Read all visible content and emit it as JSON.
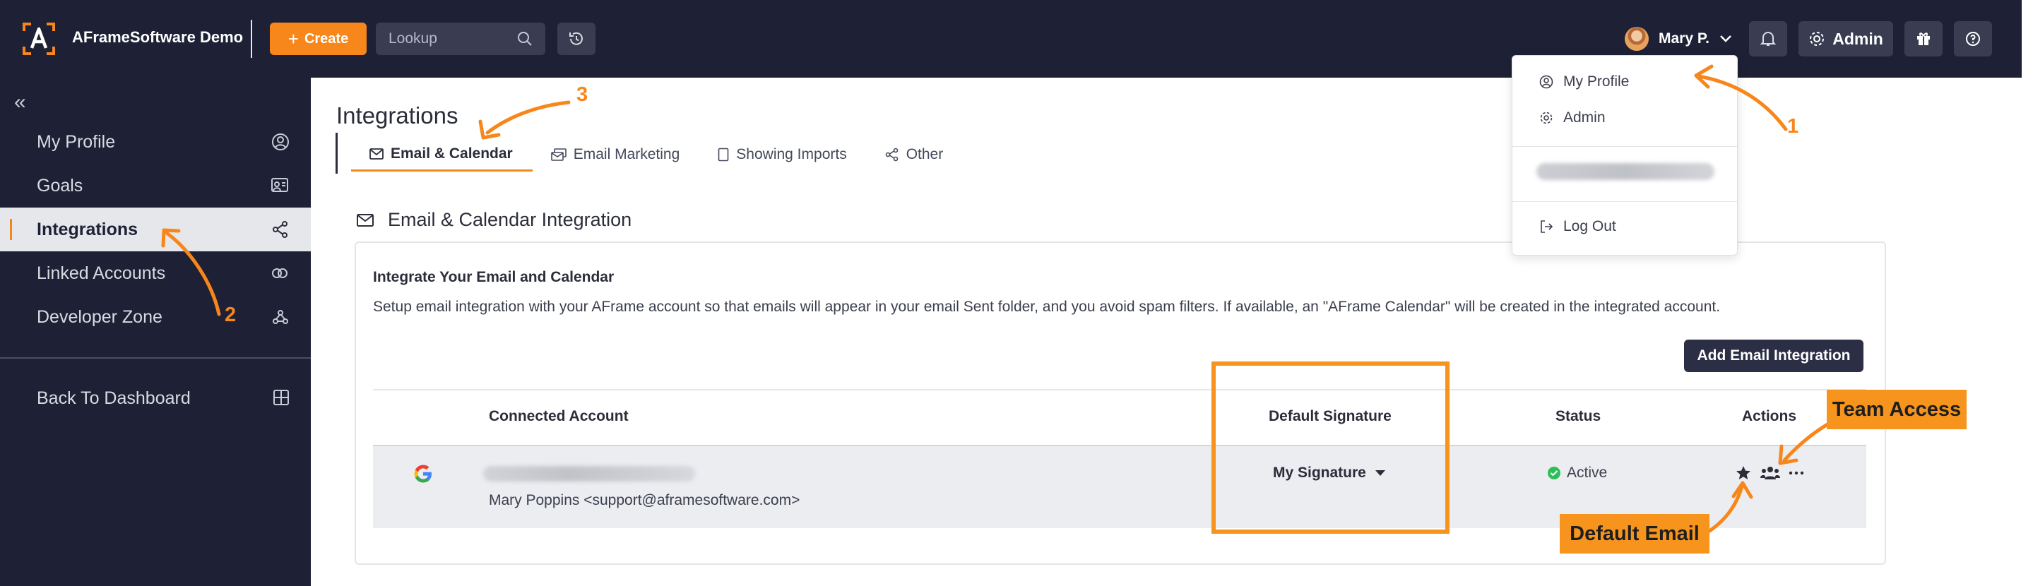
{
  "app": {
    "title": "AFrameSoftware Demo"
  },
  "topbar": {
    "create_label": "Create",
    "lookup_placeholder": "Lookup",
    "user_name": "Mary P.",
    "admin_label": "Admin"
  },
  "sidebar": {
    "collapse_glyph": "«",
    "items": [
      {
        "label": "My Profile",
        "icon": "user-circle-icon"
      },
      {
        "label": "Goals",
        "icon": "goals-icon"
      },
      {
        "label": "Integrations",
        "icon": "share-nodes-icon",
        "active": true
      },
      {
        "label": "Linked Accounts",
        "icon": "link-icon"
      },
      {
        "label": "Developer Zone",
        "icon": "webhook-icon"
      }
    ],
    "back_label": "Back To Dashboard"
  },
  "page": {
    "title": "Integrations",
    "tabs": [
      {
        "label": "Email & Calendar",
        "active": true
      },
      {
        "label": "Email Marketing"
      },
      {
        "label": "Showing Imports"
      },
      {
        "label": "Other"
      }
    ]
  },
  "integration": {
    "section_title": "Email & Calendar Integration",
    "heading": "Integrate Your Email and Calendar",
    "description": "Setup email integration with your AFrame account so that emails will appear in your email Sent folder, and you avoid spam filters. If available, an \"AFrame Calendar\" will be created in the integrated account.",
    "add_button": "Add Email Integration",
    "columns": [
      "Connected Account",
      "Default Signature",
      "Status",
      "Actions"
    ],
    "rows": [
      {
        "provider": "google",
        "account_name": "Mary Poppins <support@aframesoftware.com>",
        "signature": "My Signature",
        "status": "Active"
      }
    ]
  },
  "user_dropdown": {
    "items": [
      "My Profile",
      "Admin"
    ],
    "logout": "Log Out"
  },
  "annotations": {
    "team_access": "Team Access",
    "default_email": "Default Email",
    "markers": [
      "1",
      "2",
      "3"
    ]
  },
  "colors": {
    "nav_bg": "#1e2135",
    "accent": "#f7861b",
    "annotation": "#f7941d",
    "status_active": "#2ebd59"
  }
}
